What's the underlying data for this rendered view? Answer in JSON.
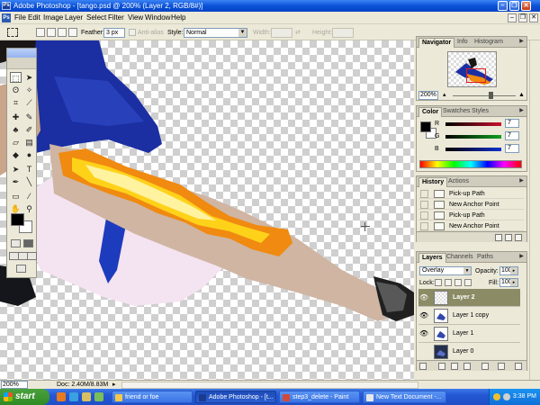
{
  "window": {
    "title": "Adobe Photoshop - [tango.psd @ 200% (Layer 2, RGB/8#)]",
    "icon_text": "Ps"
  },
  "menu": {
    "items": [
      "File",
      "Edit",
      "Image",
      "Layer",
      "Select",
      "Filter",
      "View",
      "Window",
      "Help"
    ]
  },
  "options": {
    "feather_label": "Feather:",
    "feather_value": "3 px",
    "antialias_label": "Anti-alias",
    "style_label": "Style:",
    "style_value": "Normal",
    "width_label": "Width:",
    "height_label": "Height:"
  },
  "navigator": {
    "tabs": [
      "Navigator",
      "Info",
      "Histogram"
    ],
    "zoom": "200%",
    "view_box_color": "#e21a1a"
  },
  "color": {
    "tabs": [
      "Color",
      "Swatches",
      "Styles"
    ],
    "channels": [
      {
        "label": "R",
        "value": "7",
        "bar_color": "#c8102e"
      },
      {
        "label": "G",
        "value": "7",
        "bar_color": "#10a020"
      },
      {
        "label": "B",
        "value": "7",
        "bar_color": "#1030d0"
      }
    ]
  },
  "history": {
    "tabs": [
      "History",
      "Actions"
    ],
    "items": [
      "Pick-up Path",
      "New Anchor Point",
      "Pick-up Path",
      "New Anchor Point"
    ]
  },
  "layers": {
    "tabs": [
      "Layers",
      "Channels",
      "Paths"
    ],
    "blend_mode": "Overlay",
    "opacity_label": "Opacity:",
    "opacity": "100%",
    "lock_label": "Lock:",
    "fill_label": "Fill:",
    "fill": "100%",
    "items": [
      {
        "name": "Layer 2",
        "selected": true,
        "visible": true
      },
      {
        "name": "Layer 1 copy",
        "selected": false,
        "visible": true
      },
      {
        "name": "Layer 1",
        "selected": false,
        "visible": true
      },
      {
        "name": "Layer 0",
        "selected": false,
        "visible": false
      }
    ]
  },
  "status": {
    "zoom": "200%",
    "doc": "Doc: 2.40M/8.83M"
  },
  "taskbar": {
    "start": "start",
    "tasks": [
      {
        "label": "friend or foe",
        "icon_color": "#f4c84a"
      },
      {
        "label": "Adobe Photoshop - [t...",
        "icon_color": "#1b3b8f",
        "active": true
      },
      {
        "label": "step3_delete - Paint",
        "icon_color": "#d04a3a"
      },
      {
        "label": "New Text Document -...",
        "icon_color": "#e8e8e8"
      }
    ],
    "clock": "3:38 PM"
  },
  "colors": {
    "titlebar": "#0a53d8",
    "selected_layer": "#8b8c66",
    "taskbar": "#2457d3",
    "start": "#2f8a24"
  }
}
